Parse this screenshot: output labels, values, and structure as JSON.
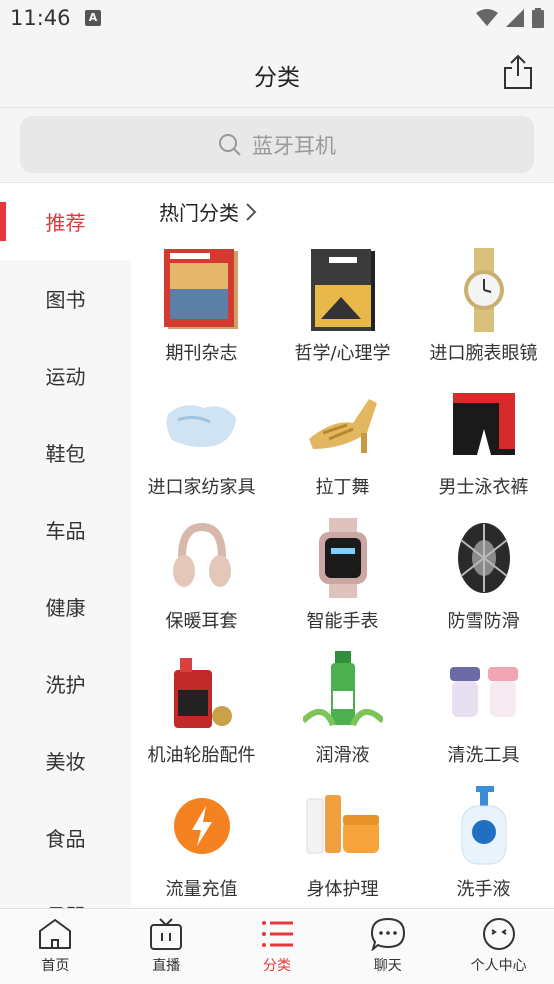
{
  "status": {
    "time": "11:46",
    "notif_letter": "A"
  },
  "header": {
    "title": "分类"
  },
  "search": {
    "placeholder": "蓝牙耳机"
  },
  "sidebar": {
    "items": [
      {
        "label": "推荐",
        "active": true
      },
      {
        "label": "图书"
      },
      {
        "label": "运动"
      },
      {
        "label": "鞋包"
      },
      {
        "label": "车品"
      },
      {
        "label": "健康"
      },
      {
        "label": "洗护"
      },
      {
        "label": "美妆"
      },
      {
        "label": "食品"
      },
      {
        "label": "母婴"
      }
    ]
  },
  "section": {
    "title": "热门分类"
  },
  "categories": [
    {
      "label": "期刊杂志",
      "icon": "magazine-icon"
    },
    {
      "label": "哲学/心理学",
      "icon": "book-icon"
    },
    {
      "label": "进口腕表眼镜",
      "icon": "watch-icon"
    },
    {
      "label": "进口家纺家具",
      "icon": "pillow-icon"
    },
    {
      "label": "拉丁舞",
      "icon": "dance-shoe-icon"
    },
    {
      "label": "男士泳衣裤",
      "icon": "swim-trunks-icon"
    },
    {
      "label": "保暖耳套",
      "icon": "earmuff-icon"
    },
    {
      "label": "智能手表",
      "icon": "smartwatch-icon"
    },
    {
      "label": "防雪防滑",
      "icon": "snow-chain-icon"
    },
    {
      "label": "机油轮胎配件",
      "icon": "engine-oil-icon"
    },
    {
      "label": "润滑液",
      "icon": "lubricant-icon"
    },
    {
      "label": "清洗工具",
      "icon": "lens-case-icon"
    },
    {
      "label": "流量充值",
      "icon": "lightning-icon"
    },
    {
      "label": "身体护理",
      "icon": "body-care-icon"
    },
    {
      "label": "洗手液",
      "icon": "hand-wash-icon"
    }
  ],
  "tabbar": {
    "items": [
      {
        "label": "首页",
        "icon": "home-icon"
      },
      {
        "label": "直播",
        "icon": "tv-icon"
      },
      {
        "label": "分类",
        "icon": "category-list-icon",
        "active": true
      },
      {
        "label": "聊天",
        "icon": "chat-icon"
      },
      {
        "label": "个人中心",
        "icon": "profile-icon"
      }
    ]
  },
  "colors": {
    "accent": "#e4393c",
    "bg": "#f5f5f5"
  }
}
